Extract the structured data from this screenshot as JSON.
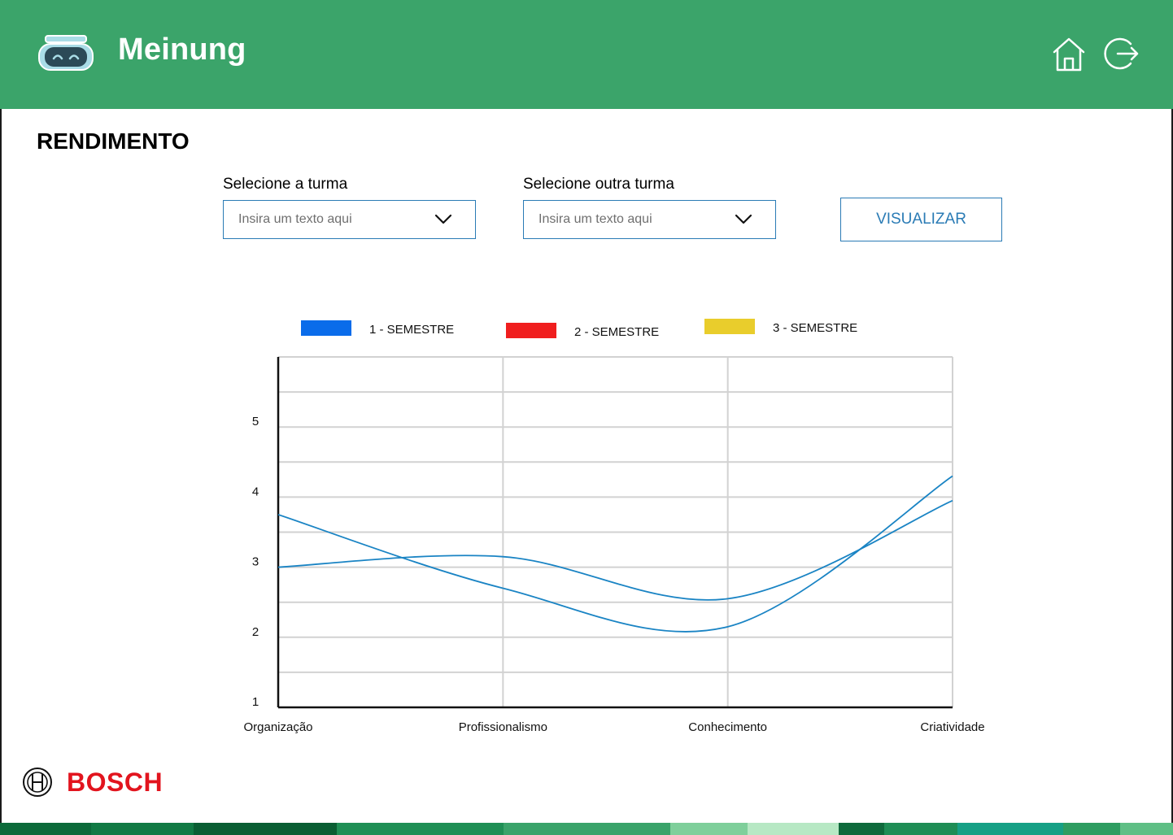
{
  "header": {
    "app_title": "Meinung",
    "logo_icon": "robot-visor-icon",
    "home_icon": "home-icon",
    "logout_icon": "logout-icon",
    "background": "#3ba46a"
  },
  "page": {
    "title": "RENDIMENTO"
  },
  "filters": {
    "turma1": {
      "label": "Selecione a turma",
      "placeholder": "Insira um texto aqui"
    },
    "turma2": {
      "label": "Selecione outra turma",
      "placeholder": "Insira um texto aqui"
    },
    "visualizar_label": "VISUALIZAR",
    "accent": "#2a7bb5"
  },
  "chart_data": {
    "type": "line",
    "categories": [
      "Organização",
      "Profissionalismo",
      "Conhecimento",
      "Criatividade"
    ],
    "ylim": [
      1,
      6
    ],
    "yticks": [
      1,
      2,
      3,
      4,
      5
    ],
    "grid": true,
    "legend_position": "top",
    "legend": [
      {
        "name": "1 - SEMESTRE",
        "color": "#0a6cea"
      },
      {
        "name": "2 - SEMESTRE",
        "color": "#f01e1e"
      },
      {
        "name": "3 - SEMESTRE",
        "color": "#e9cd2c"
      }
    ],
    "series": [
      {
        "color": "#1a84c4",
        "values": [
          3.0,
          3.15,
          2.55,
          3.95
        ]
      },
      {
        "color": "#1a84c4",
        "values": [
          3.75,
          2.7,
          2.15,
          4.3
        ]
      }
    ]
  },
  "footer": {
    "brand": "BOSCH",
    "brand_icon": "bosch-armature-icon",
    "brand_color": "#e2141e",
    "stripe_colors": [
      "#0c6a3a",
      "#117a44",
      "#0a5e33",
      "#1f8f55",
      "#3aa36a",
      "#7fcf9b",
      "#b7e8c4",
      "#0f6a3c",
      "#1e8d55",
      "#16a085",
      "#2e9d61",
      "#5fbf85"
    ]
  }
}
